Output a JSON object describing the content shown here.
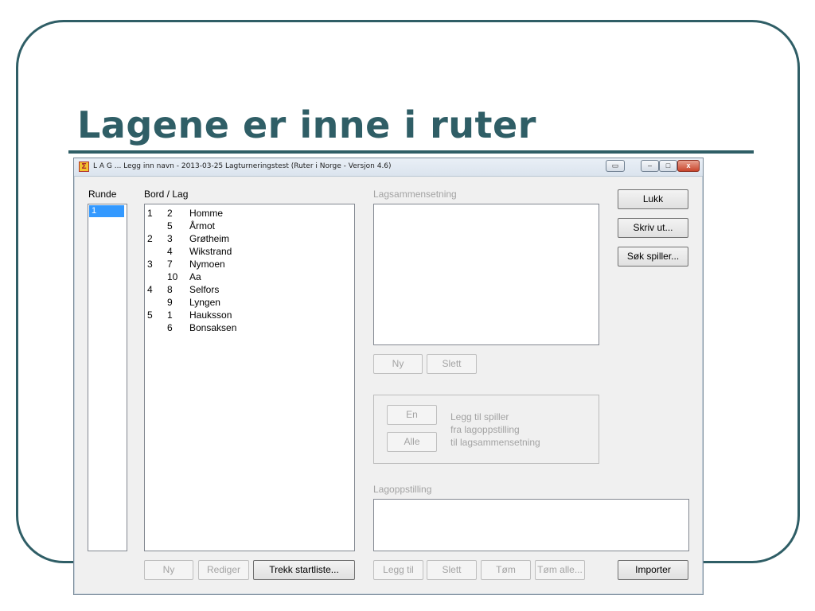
{
  "slide": {
    "title": "Lagene er inne i ruter"
  },
  "window": {
    "title": "L A G ... Legg inn navn - 2013-03-25  Lagturneringstest  (Ruter i Norge - Versjon 4.6)",
    "icon": "app-icon",
    "controls": [
      "minimize",
      "maximize",
      "close"
    ],
    "close_glyph": "x"
  },
  "runde": {
    "label": "Runde",
    "items": [
      "1"
    ],
    "selected": "1"
  },
  "bord_lag": {
    "label": "Bord / Lag",
    "rows": [
      {
        "bord": "1",
        "nr": "2",
        "navn": "Homme"
      },
      {
        "bord": "",
        "nr": "5",
        "navn": "Årmot"
      },
      {
        "bord": "2",
        "nr": "3",
        "navn": "Grøtheim"
      },
      {
        "bord": "",
        "nr": "4",
        "navn": "Wikstrand"
      },
      {
        "bord": "3",
        "nr": "7",
        "navn": "Nymoen"
      },
      {
        "bord": "",
        "nr": "10",
        "navn": "Aa"
      },
      {
        "bord": "4",
        "nr": "8",
        "navn": "Selfors"
      },
      {
        "bord": "",
        "nr": "9",
        "navn": "Lyngen"
      },
      {
        "bord": "5",
        "nr": "1",
        "navn": "Hauksson"
      },
      {
        "bord": "",
        "nr": "6",
        "navn": "Bonsaksen"
      }
    ],
    "buttons": {
      "ny": "Ny",
      "rediger": "Rediger",
      "trekk": "Trekk startliste..."
    }
  },
  "lagsammensetning": {
    "label": "Lagsammensetning",
    "buttons": {
      "ny": "Ny",
      "slett": "Slett"
    }
  },
  "legg_til": {
    "en": "En",
    "alle": "Alle",
    "hint_line1": "Legg til spiller",
    "hint_line2": "fra lagoppstilling",
    "hint_line3": "til lagsammensetning"
  },
  "lagoppstilling": {
    "label": "Lagoppstilling",
    "buttons": {
      "legg_til": "Legg til",
      "slett": "Slett",
      "tom": "Tøm",
      "tom_alle": "Tøm alle..."
    }
  },
  "right_buttons": {
    "lukk": "Lukk",
    "skriv_ut": "Skriv ut...",
    "sok_spiller": "Søk spiller...",
    "importer": "Importer"
  }
}
